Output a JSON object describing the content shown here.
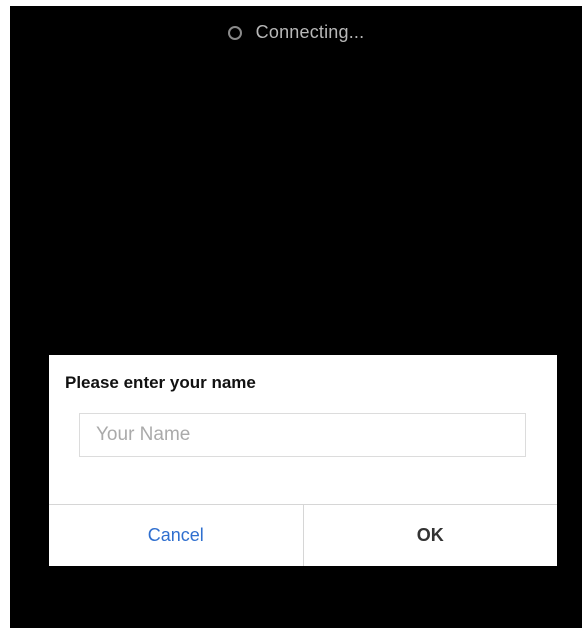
{
  "status": {
    "icon": "spinner-icon",
    "text": "Connecting..."
  },
  "dialog": {
    "title": "Please enter your name",
    "input": {
      "value": "",
      "placeholder": "Your Name"
    },
    "buttons": {
      "cancel_label": "Cancel",
      "ok_label": "OK"
    }
  },
  "colors": {
    "background": "#000000",
    "dialog_background": "#ffffff",
    "cancel_text": "#2f6fcf",
    "ok_text": "#333333"
  }
}
